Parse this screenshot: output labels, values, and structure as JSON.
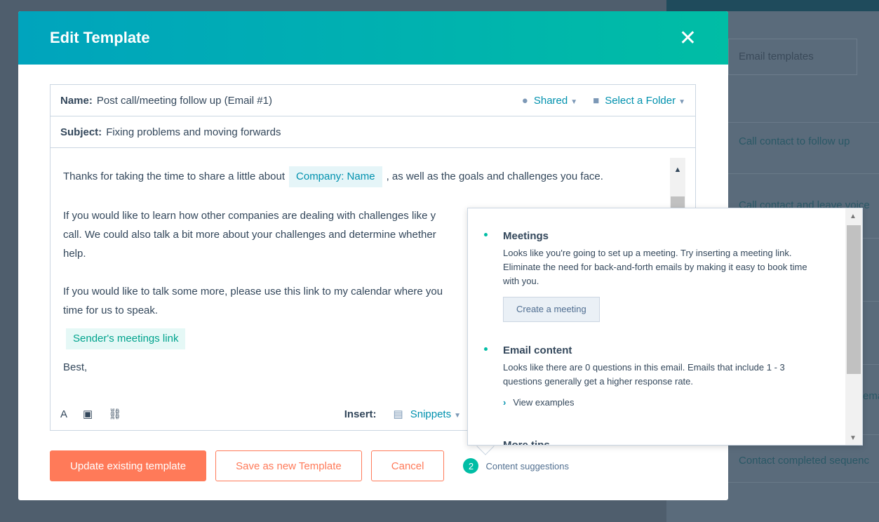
{
  "background": {
    "email_templates": "Email templates",
    "rows": [
      "Call contact to follow up",
      "Call contact and leave voice",
      "ema",
      "Contact completed sequenc"
    ]
  },
  "modal": {
    "title": "Edit Template",
    "close_icon": "close-icon",
    "name_label": "Name:",
    "name_value": "Post call/meeting follow up (Email #1)",
    "shared": "Shared",
    "folder": "Select a Folder",
    "subject_label": "Subject:",
    "subject_value": "Fixing problems and moving forwards",
    "body": {
      "p1a": "Thanks for taking the time to share a little about",
      "token1": "Company: Name",
      "p1b": ", as well as the goals and challenges you face.",
      "p2l1": "If you would like to learn how other companies are dealing with challenges like y",
      "p2l2": "call. We could also talk a bit more about your challenges and determine whether",
      "p2l3": "help.",
      "p3l1": "If you would like to talk some more, please use this link to my calendar where you",
      "p3l2": "time for us to speak.",
      "token2": "Sender's meetings link",
      "sign": "Best,"
    },
    "toolbar": {
      "insert": "Insert:",
      "snippets": "Snippets"
    },
    "buttons": {
      "update": "Update existing template",
      "save_new": "Save as new Template",
      "cancel": "Cancel"
    },
    "suggestions": {
      "count": "2",
      "label": "Content suggestions"
    }
  },
  "popover": {
    "meetings": {
      "title": "Meetings",
      "text": "Looks like you're going to set up a meeting. Try inserting a meeting link. Eliminate the need for back-and-forth emails by making it easy to book time with you.",
      "button": "Create a meeting"
    },
    "email": {
      "title": "Email content",
      "text": "Looks like there are 0 questions in this email. Emails that include 1 - 3 questions generally get a higher response rate.",
      "link": "View examples"
    },
    "more": "More tips"
  },
  "colors": {
    "accent": "#00bda5",
    "primary_button": "#ff7a59",
    "link": "#0091ae"
  }
}
